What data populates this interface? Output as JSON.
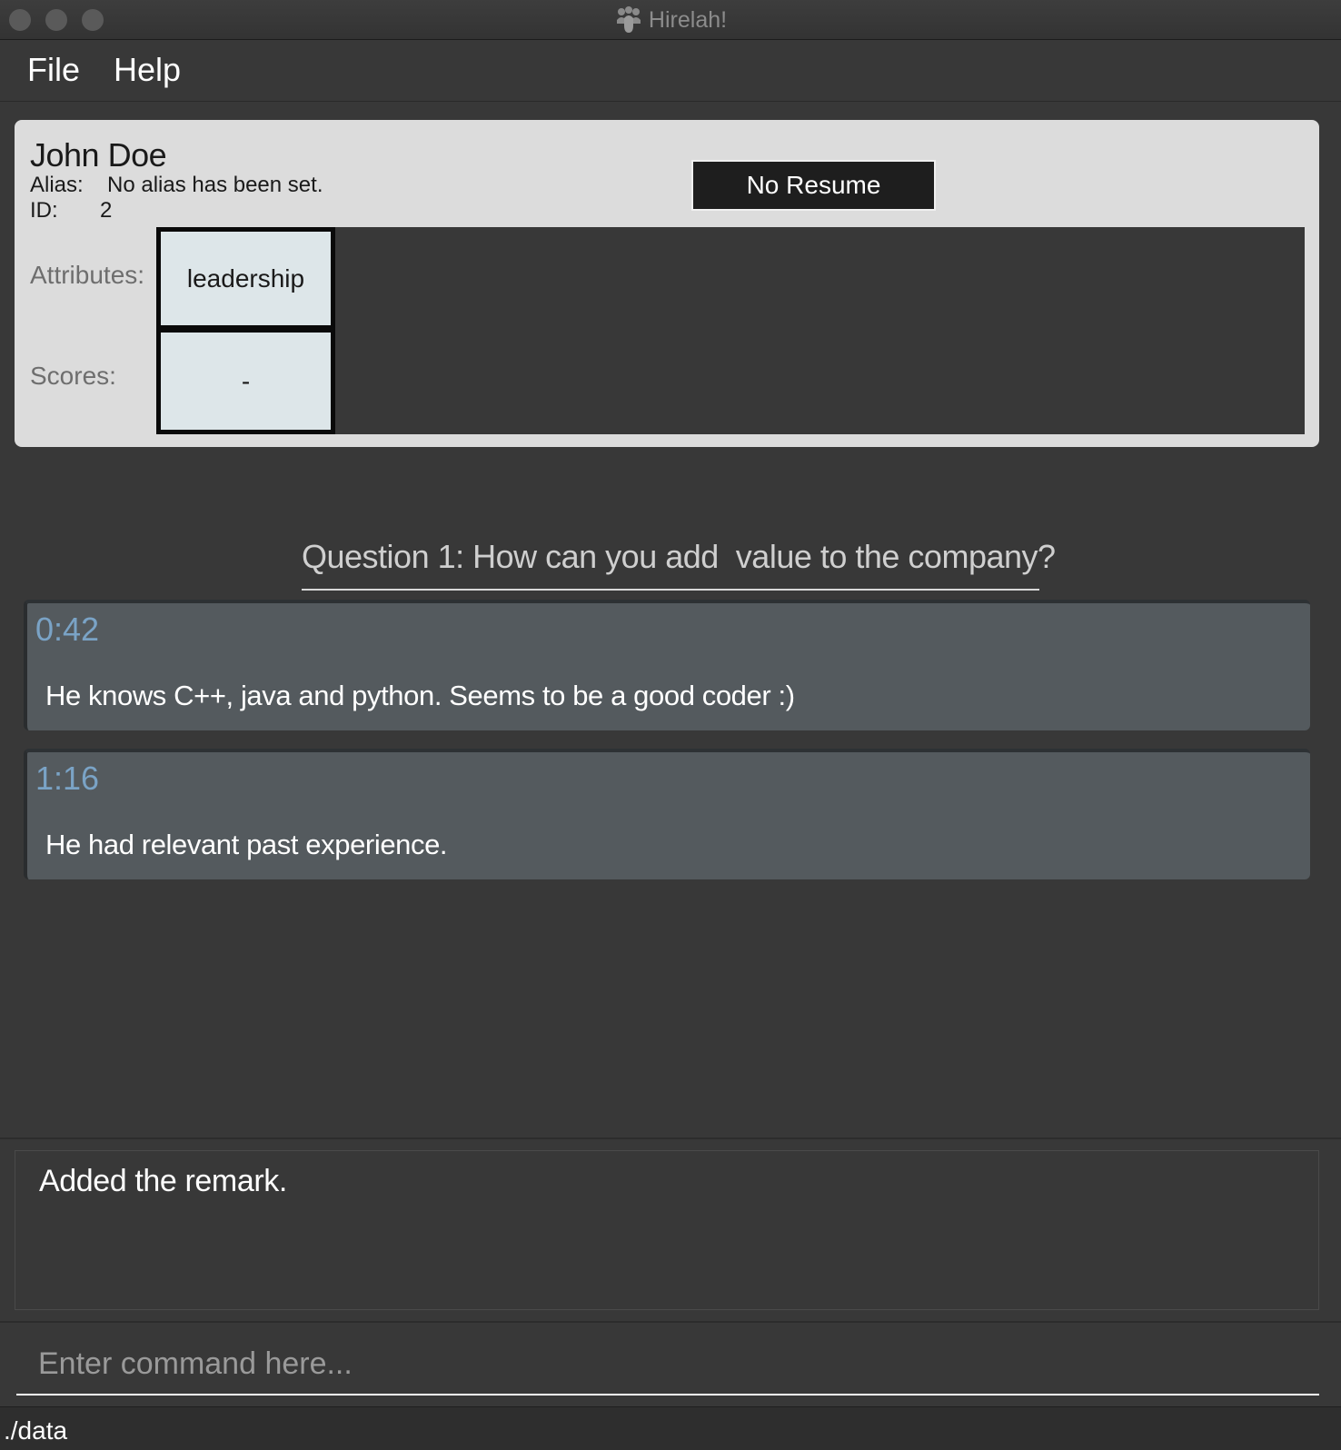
{
  "window": {
    "title": "Hirelah!",
    "app_icon": "people-group-icon"
  },
  "menu": {
    "file_label": "File",
    "help_label": "Help"
  },
  "candidate": {
    "name": "John Doe",
    "alias_label": "Alias:",
    "alias_value": "No alias has been set.",
    "id_label": "ID:",
    "id_value": "2",
    "resume_button": "No Resume",
    "attributes_label": "Attributes:",
    "scores_label": "Scores:",
    "attributes": [
      "leadership"
    ],
    "scores": [
      "-"
    ]
  },
  "question": {
    "text": "Question 1: How can you add  value to the company?"
  },
  "remarks": [
    {
      "time": "0:42",
      "text": "He knows C++, java and python. Seems to be a good coder :)"
    },
    {
      "time": "1:16",
      "text": "He had relevant past experience."
    }
  ],
  "result": {
    "text": "Added the remark."
  },
  "command": {
    "placeholder": "Enter command here...",
    "value": ""
  },
  "status": {
    "path": "./data"
  },
  "colors": {
    "background": "#383838",
    "card": "#dcdcdc",
    "remark_card": "#545a5e",
    "remark_time": "#7aa3c6",
    "cell": "#dde6e9"
  }
}
